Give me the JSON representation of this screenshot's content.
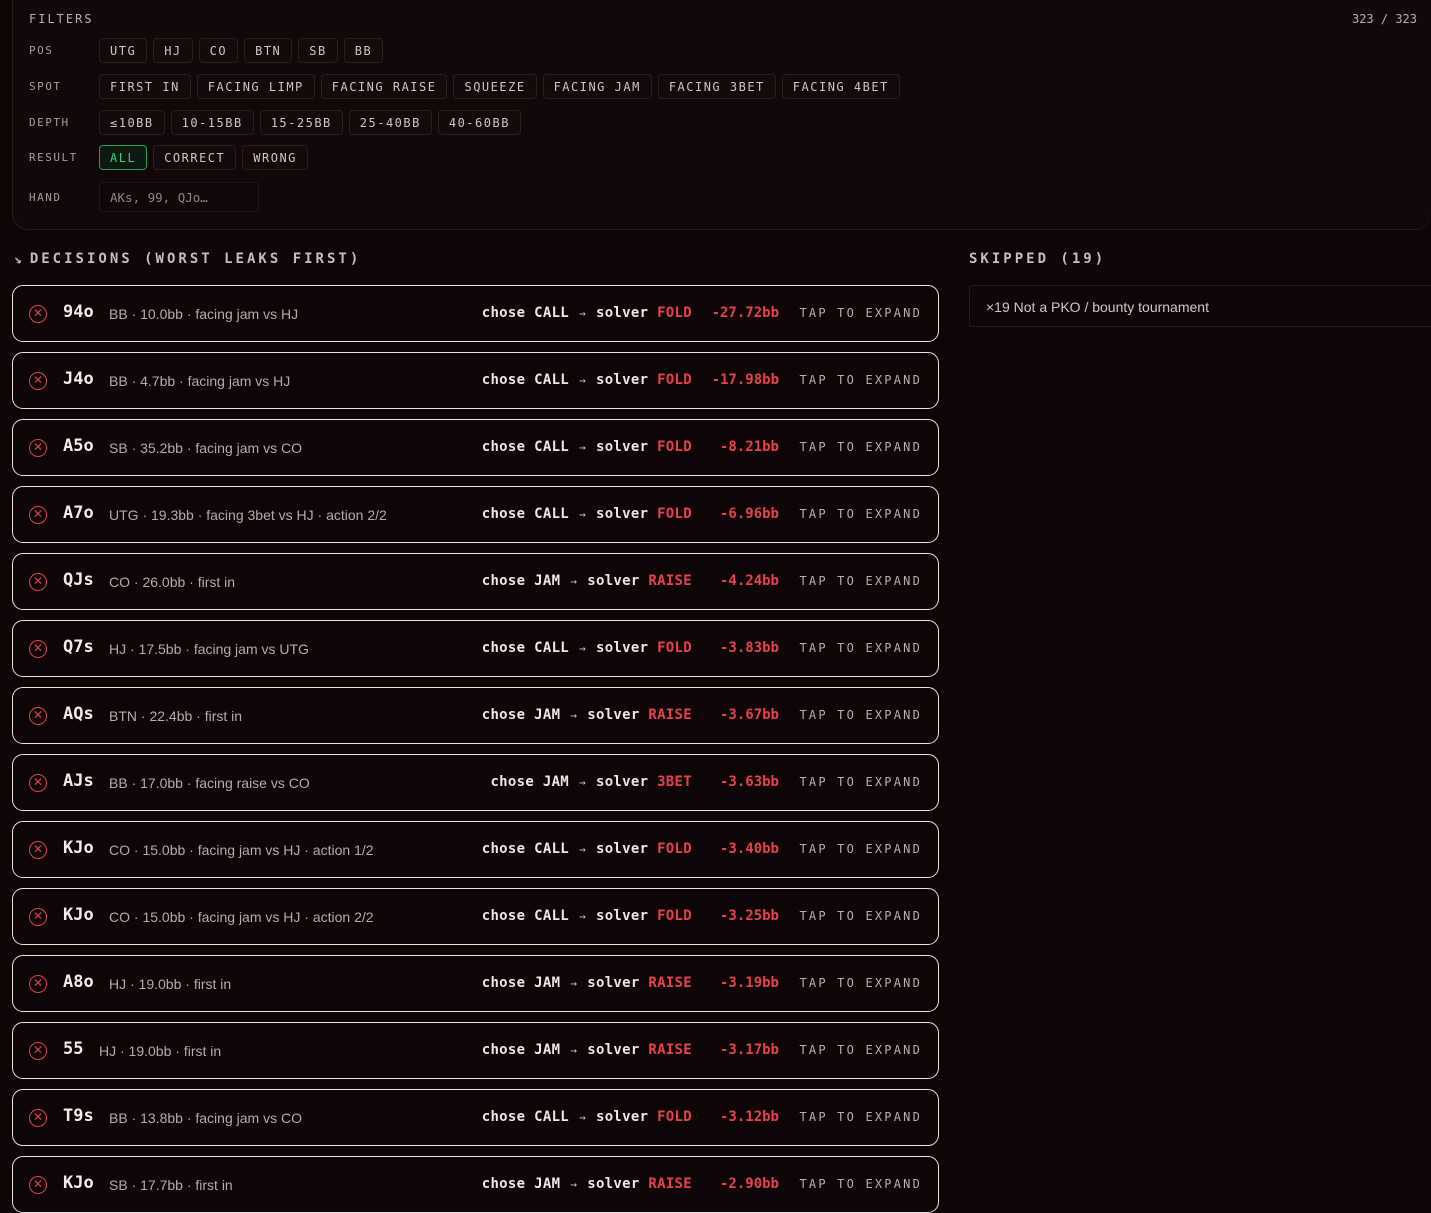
{
  "filters": {
    "title": "FILTERS",
    "count": "323 / 323",
    "pos": {
      "label": "POS",
      "options": [
        "UTG",
        "HJ",
        "CO",
        "BTN",
        "SB",
        "BB"
      ]
    },
    "spot": {
      "label": "SPOT",
      "options": [
        "FIRST IN",
        "FACING LIMP",
        "FACING RAISE",
        "SQUEEZE",
        "FACING JAM",
        "FACING 3BET",
        "FACING 4BET"
      ]
    },
    "depth": {
      "label": "DEPTH",
      "options": [
        "≤10BB",
        "10-15BB",
        "15-25BB",
        "25-40BB",
        "40-60BB"
      ]
    },
    "result": {
      "label": "RESULT",
      "options": [
        "ALL",
        "CORRECT",
        "WRONG"
      ],
      "selected": "ALL"
    },
    "hand": {
      "label": "HAND",
      "placeholder": "AKs, 99, QJo…"
    }
  },
  "decisions": {
    "title": "DECISIONS (WORST LEAKS FIRST)",
    "icon": "trending-down-icon",
    "tap_label": "TAP TO EXPAND",
    "rows": [
      {
        "hand": "94o",
        "context": "BB · 10.0bb · facing jam vs HJ",
        "chose": "CALL",
        "solver": "FOLD",
        "loss": "-27.72bb"
      },
      {
        "hand": "J4o",
        "context": "BB · 4.7bb · facing jam vs HJ",
        "chose": "CALL",
        "solver": "FOLD",
        "loss": "-17.98bb"
      },
      {
        "hand": "A5o",
        "context": "SB · 35.2bb · facing jam vs CO",
        "chose": "CALL",
        "solver": "FOLD",
        "loss": "-8.21bb"
      },
      {
        "hand": "A7o",
        "context": "UTG · 19.3bb · facing 3bet vs HJ · action 2/2",
        "chose": "CALL",
        "solver": "FOLD",
        "loss": "-6.96bb"
      },
      {
        "hand": "QJs",
        "context": "CO · 26.0bb · first in",
        "chose": "JAM",
        "solver": "RAISE",
        "loss": "-4.24bb"
      },
      {
        "hand": "Q7s",
        "context": "HJ · 17.5bb · facing jam vs UTG",
        "chose": "CALL",
        "solver": "FOLD",
        "loss": "-3.83bb"
      },
      {
        "hand": "AQs",
        "context": "BTN · 22.4bb · first in",
        "chose": "JAM",
        "solver": "RAISE",
        "loss": "-3.67bb"
      },
      {
        "hand": "AJs",
        "context": "BB · 17.0bb · facing raise vs CO",
        "chose": "JAM",
        "solver": "3BET",
        "loss": "-3.63bb"
      },
      {
        "hand": "KJo",
        "context": "CO · 15.0bb · facing jam vs HJ · action 1/2",
        "chose": "CALL",
        "solver": "FOLD",
        "loss": "-3.40bb"
      },
      {
        "hand": "KJo",
        "context": "CO · 15.0bb · facing jam vs HJ · action 2/2",
        "chose": "CALL",
        "solver": "FOLD",
        "loss": "-3.25bb"
      },
      {
        "hand": "A8o",
        "context": "HJ · 19.0bb · first in",
        "chose": "JAM",
        "solver": "RAISE",
        "loss": "-3.19bb"
      },
      {
        "hand": "55",
        "context": "HJ · 19.0bb · first in",
        "chose": "JAM",
        "solver": "RAISE",
        "loss": "-3.17bb"
      },
      {
        "hand": "T9s",
        "context": "BB · 13.8bb · facing jam vs CO",
        "chose": "CALL",
        "solver": "FOLD",
        "loss": "-3.12bb"
      },
      {
        "hand": "KJo",
        "context": "SB · 17.7bb · first in",
        "chose": "JAM",
        "solver": "RAISE",
        "loss": "-2.90bb"
      }
    ]
  },
  "skipped": {
    "title": "SKIPPED (19)",
    "items": [
      "×19 Not a PKO / bounty tournament"
    ]
  },
  "labels": {
    "chose": "chose",
    "solver": "solver",
    "arrow": "→"
  },
  "colors": {
    "accent_red": "#e8414c",
    "accent_green": "#2fd07a",
    "background": "#0d0506"
  }
}
